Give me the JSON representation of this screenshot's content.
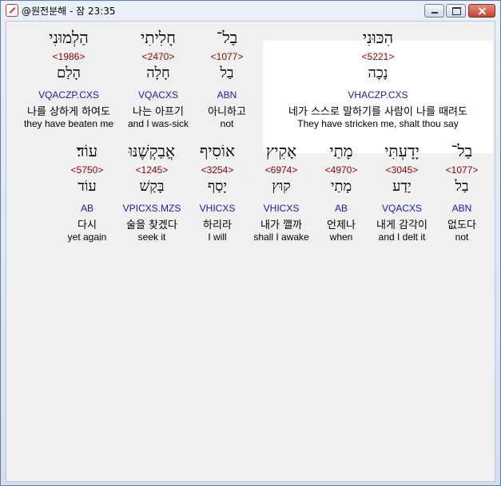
{
  "window": {
    "title": "@원전분해 - 잠 23:35"
  },
  "row1": [
    {
      "heb": "הַלְמוּנִי",
      "num": "<1986>",
      "lex": "הָלַם",
      "morph": "VQACZP.CXS",
      "kor": "나를 상하게 하여도",
      "eng": "they have beaten me"
    },
    {
      "heb": "חָלִיתִי",
      "num": "<2470>",
      "lex": "חָלָה",
      "morph": "VQACXS",
      "kor": "나는 아프기",
      "eng": "and I was-sick"
    },
    {
      "heb": "בַל־",
      "num": "<1077>",
      "lex": "בַל",
      "morph": "ABN",
      "kor": "아니하고",
      "eng": "not"
    },
    {
      "heb": "הִכּוּנִי",
      "num": "<5221>",
      "lex": "נָכָה",
      "morph": "VHACZP.CXS",
      "kor": "네가 스스로 말하기를 사람이 나를 때려도",
      "eng": "They have stricken me, shalt thou say"
    }
  ],
  "row2": [
    {
      "heb": "עוֹד׃",
      "num": "<5750>",
      "lex": "עוֹד",
      "morph": "AB",
      "kor": "다시",
      "eng": "yet again"
    },
    {
      "heb": "אֲבַקְשֶׁנּוּ",
      "num": "<1245>",
      "lex": "בָּקַשׁ",
      "morph": "VPICXS.MZS",
      "kor": "술을 찾겠다",
      "eng": "seek it"
    },
    {
      "heb": "אוֹסִיף",
      "num": "<3254>",
      "lex": "יָסַף",
      "morph": "VHICXS",
      "kor": "하리라",
      "eng": "I will"
    },
    {
      "heb": "אָקִיץ",
      "num": "<6974>",
      "lex": "קוּץ",
      "morph": "VHICXS",
      "kor": "내가 깰까",
      "eng": "shall I awake"
    },
    {
      "heb": "מָתַי",
      "num": "<4970>",
      "lex": "מָתַי",
      "morph": "AB",
      "kor": "언제나",
      "eng": "when"
    },
    {
      "heb": "יָדָעְתִּי",
      "num": "<3045>",
      "lex": "יָדַע",
      "morph": "VQACXS",
      "kor": "내게 감각이",
      "eng": "and I delt it"
    },
    {
      "heb": "בַל־",
      "num": "<1077>",
      "lex": "בַל",
      "morph": "ABN",
      "kor": "없도다",
      "eng": "not"
    }
  ]
}
